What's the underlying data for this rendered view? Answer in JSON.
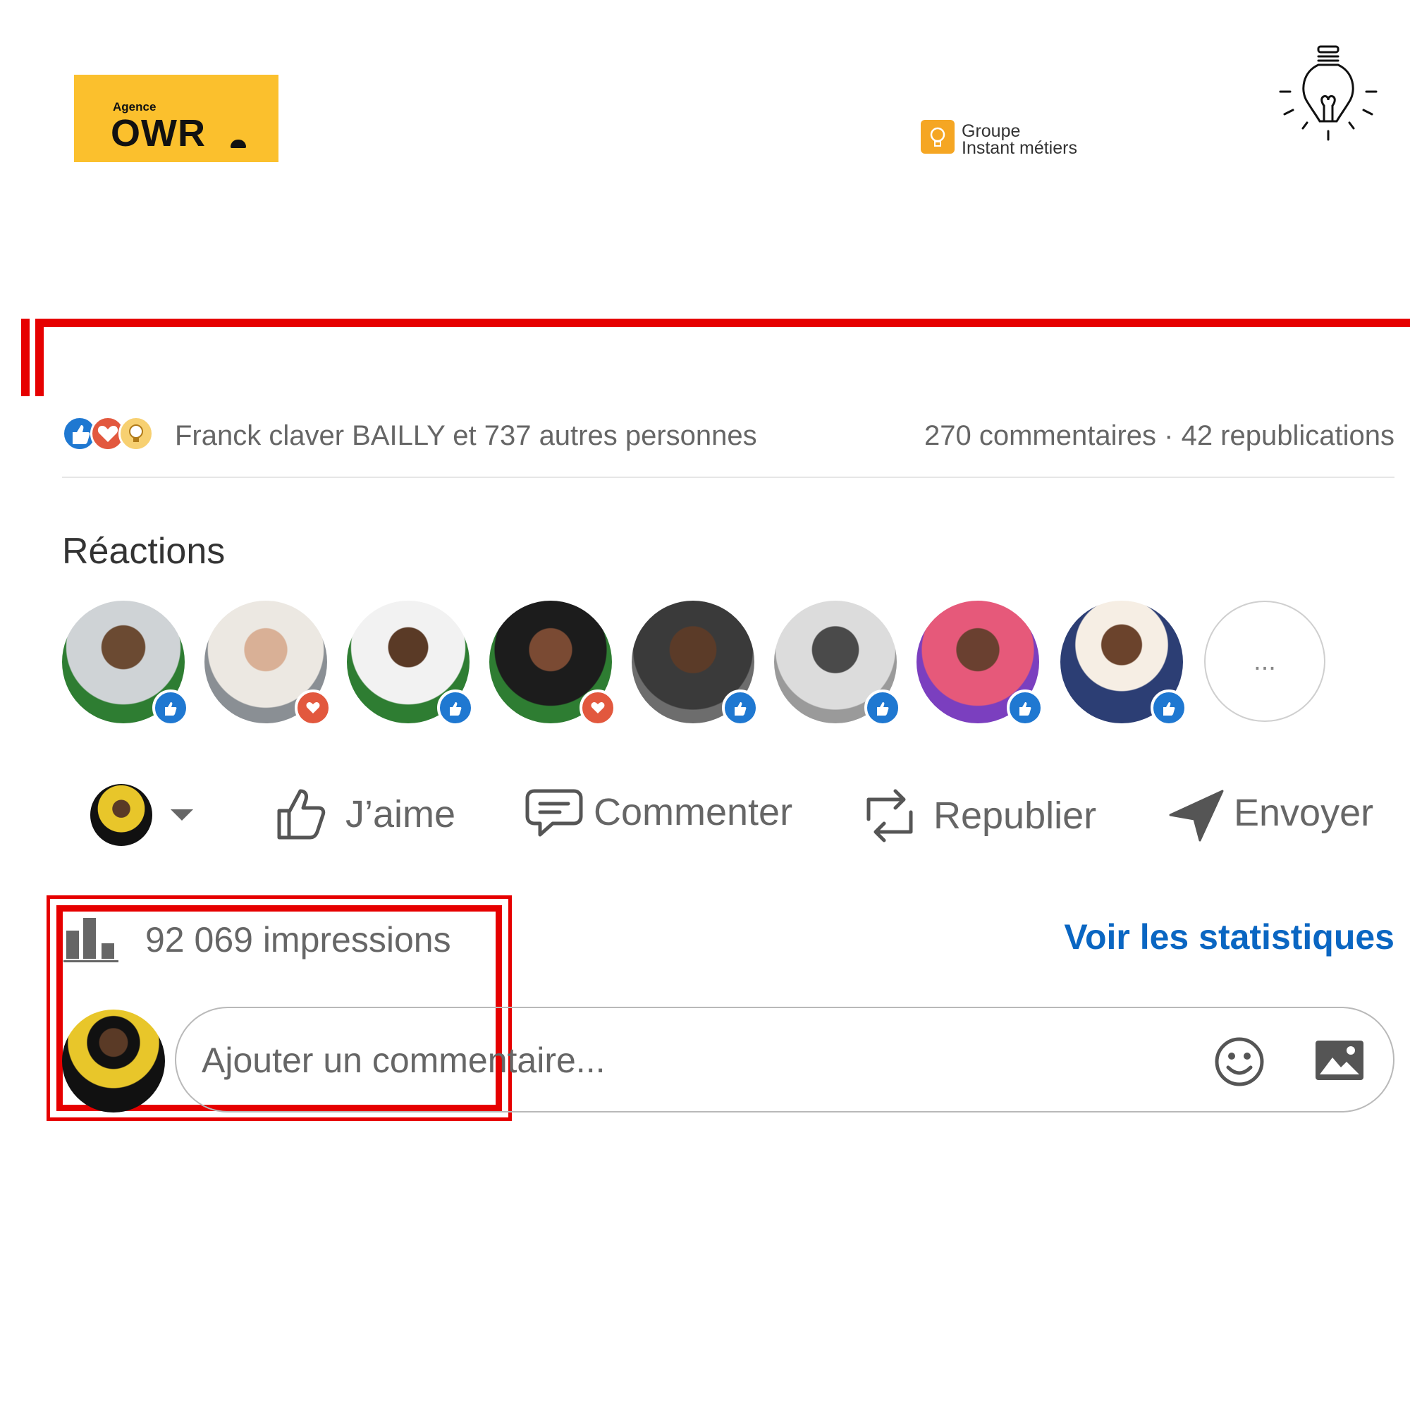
{
  "branding": {
    "agency_small": "Agence",
    "agency_name": "OWR",
    "group_line1": "Groupe",
    "group_line2": "Instant métiers",
    "yellow": "#fbc02d",
    "orange": "#f5a623"
  },
  "reaction_summary": {
    "icons": [
      "like-icon",
      "love-icon",
      "insightful-icon"
    ],
    "text": "Franck claver BAILLY et 737 autres personnes",
    "counts": "270 commentaires · 42 republications"
  },
  "reactions_section": {
    "title": "Réactions",
    "avatars": [
      {
        "name": "reactor-1",
        "reaction": "like"
      },
      {
        "name": "reactor-2",
        "reaction": "love"
      },
      {
        "name": "reactor-3",
        "reaction": "like"
      },
      {
        "name": "reactor-4",
        "reaction": "love"
      },
      {
        "name": "reactor-5",
        "reaction": "like"
      },
      {
        "name": "reactor-6",
        "reaction": "like"
      },
      {
        "name": "reactor-7",
        "reaction": "like"
      },
      {
        "name": "reactor-8",
        "reaction": "like"
      }
    ],
    "more_label": "..."
  },
  "actions": {
    "like": "J’aime",
    "comment": "Commenter",
    "repost": "Republier",
    "send": "Envoyer"
  },
  "stats": {
    "impressions": "92 069 impressions",
    "link": "Voir les statistiques"
  },
  "comment_box": {
    "placeholder": "Ajouter un commentaire..."
  },
  "colors": {
    "highlight_red": "#e60000",
    "link_blue": "#0a66c2",
    "like_blue": "#1f78d1",
    "love_red": "#e2583e"
  }
}
